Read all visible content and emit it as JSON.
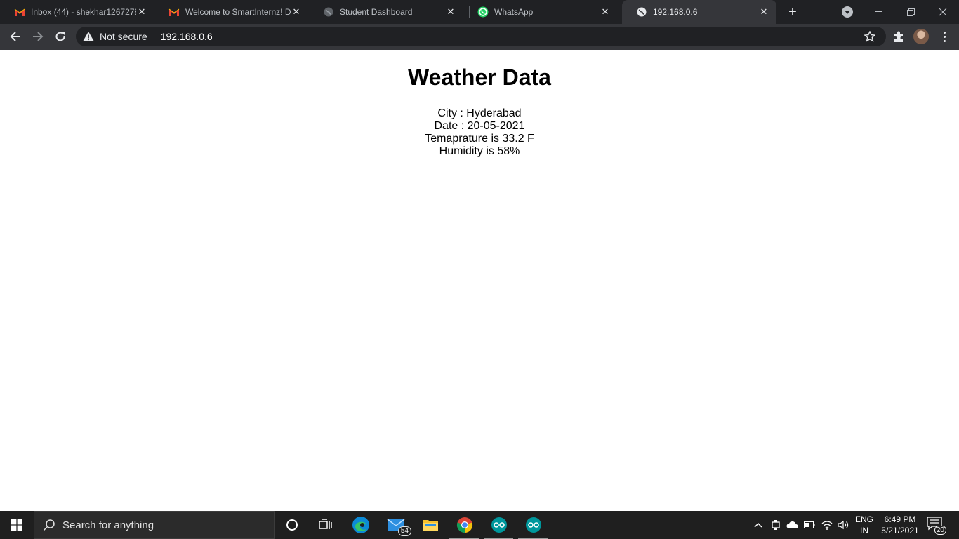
{
  "browser": {
    "tabs": [
      {
        "title": "Inbox (44) - shekhar12672780",
        "icon": "gmail-icon",
        "active": false
      },
      {
        "title": "Welcome to SmartInternz! De",
        "icon": "gmail-icon",
        "active": false
      },
      {
        "title": "Student Dashboard",
        "icon": "globe-icon",
        "active": false
      },
      {
        "title": "WhatsApp",
        "icon": "whatsapp-icon",
        "active": false
      },
      {
        "title": "192.168.0.6",
        "icon": "globe-icon",
        "active": true
      }
    ],
    "address": {
      "security_label": "Not secure",
      "url": "192.168.0.6"
    }
  },
  "page": {
    "heading": "Weather Data",
    "lines": [
      "City : Hyderabad",
      "Date : 20-05-2021",
      "Temaprature is 33.2 F",
      "Humidity is 58%"
    ]
  },
  "taskbar": {
    "search_placeholder": "Search for anything",
    "mail_badge": "54",
    "language": {
      "line1": "ENG",
      "line2": "IN"
    },
    "clock": {
      "time": "6:49 PM",
      "date": "5/21/2021"
    },
    "notification_count": "20"
  },
  "colors": {
    "tabstrip": "#202124",
    "toolbar": "#35363a",
    "taskbar": "#1f1f1f"
  }
}
